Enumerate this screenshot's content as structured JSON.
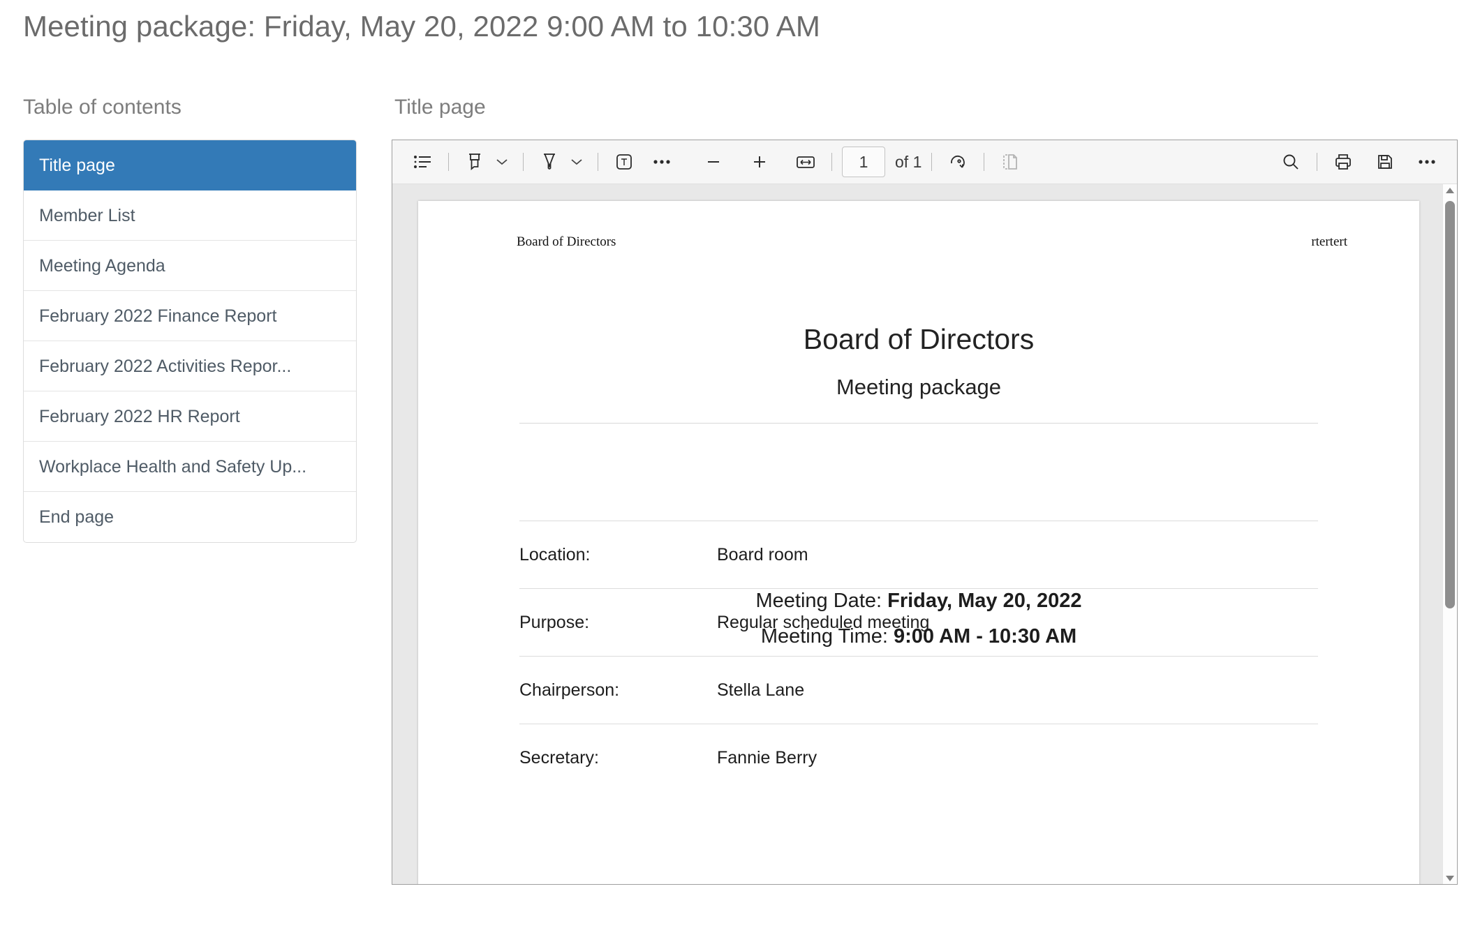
{
  "page_title": "Meeting package: Friday, May 20, 2022 9:00 AM to 10:30 AM",
  "toc": {
    "heading": "Table of contents",
    "items": [
      {
        "label": "Title page",
        "active": true
      },
      {
        "label": "Member List",
        "active": false
      },
      {
        "label": "Meeting Agenda",
        "active": false
      },
      {
        "label": "February 2022 Finance Report",
        "active": false
      },
      {
        "label": "February 2022 Activities Repor...",
        "active": false
      },
      {
        "label": "February 2022 HR Report",
        "active": false
      },
      {
        "label": "Workplace Health and Safety Up...",
        "active": false
      },
      {
        "label": "End page",
        "active": false
      }
    ]
  },
  "viewer": {
    "heading": "Title page",
    "toolbar": {
      "outline_label": "Outline",
      "highlight_label": "Highlight",
      "highlight_caret_label": "Highlight options",
      "pen_label": "Draw",
      "pen_caret_label": "Draw options",
      "text_label": "Add text",
      "more_annotation_label": "More annotation tools",
      "zoom_out_label": "Zoom out",
      "zoom_in_label": "Zoom in",
      "fit_width_label": "Fit width",
      "page_number": "1",
      "page_of": "of 1",
      "rotate_label": "Rotate",
      "dual_page_label": "Dual page view",
      "search_label": "Search",
      "print_label": "Print",
      "save_label": "Save",
      "more_label": "More"
    },
    "document": {
      "header_left": "Board of Directors",
      "header_right": "rtertert",
      "title": "Board of Directors",
      "subtitle": "Meeting package",
      "meeting_date_label": "Meeting Date:",
      "meeting_date_value": "Friday, May 20, 2022",
      "meeting_time_label": "Meeting Time:",
      "meeting_time_value": "9:00 AM - 10:30 AM",
      "rows": [
        {
          "label": "Location:",
          "value": "Board room"
        },
        {
          "label": "Purpose:",
          "value": "Regular scheduled meeting"
        },
        {
          "label": "Chairperson:",
          "value": "Stella Lane"
        },
        {
          "label": "Secretary:",
          "value": "Fannie Berry"
        }
      ]
    }
  },
  "colors": {
    "accent": "#337ab7",
    "heading_text": "#7d7d7d",
    "toolbar_bg": "#f6f6f6",
    "page_bg": "#e8e8e8"
  }
}
